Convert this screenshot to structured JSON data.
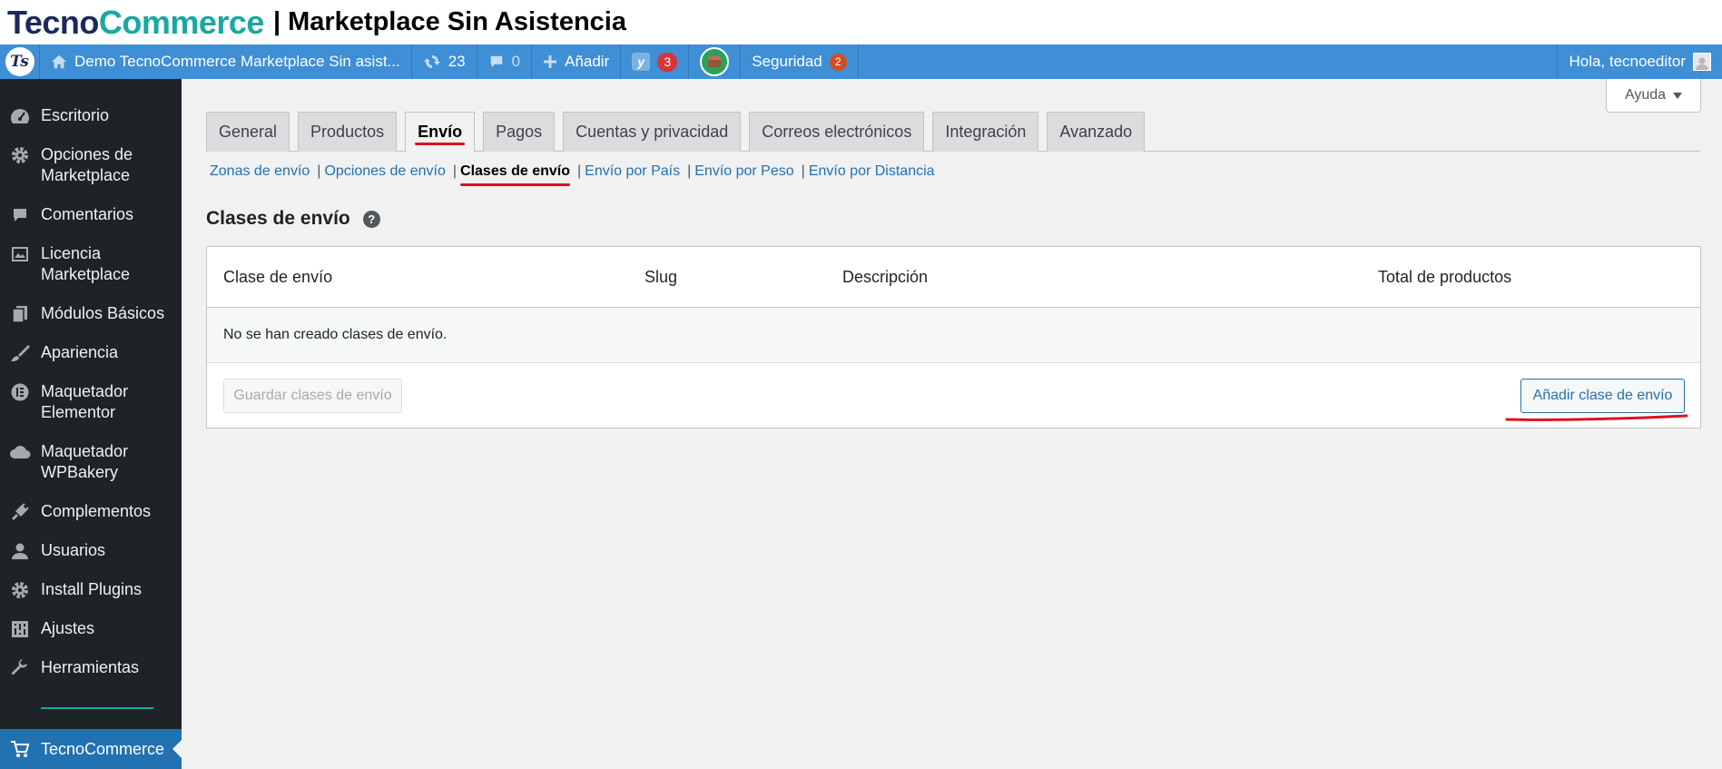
{
  "brand": {
    "part1": "Tecno",
    "part2": "Commerce",
    "title": "| Marketplace Sin Asistencia"
  },
  "adminbar": {
    "site_name": "Demo TecnoCommerce Marketplace Sin asist...",
    "updates_count": "23",
    "comments_count": "0",
    "add_label": "Añadir",
    "yoast_count": "3",
    "security_label": "Seguridad",
    "security_count": "2",
    "greeting": "Hola, tecnoeditor"
  },
  "help_label": "Ayuda",
  "sidebar": {
    "items": [
      {
        "label": "Escritorio",
        "icon": "dashboard-icon"
      },
      {
        "label": "Opciones de Marketplace",
        "icon": "gear-icon"
      },
      {
        "label": "Comentarios",
        "icon": "comment-icon"
      },
      {
        "label": "Licencia Marketplace",
        "icon": "license-icon"
      },
      {
        "label": "Módulos Básicos",
        "icon": "pages-icon"
      },
      {
        "label": "Apariencia",
        "icon": "brush-icon"
      },
      {
        "label": "Maquetador Elementor",
        "icon": "elementor-icon"
      },
      {
        "label": "Maquetador WPBakery",
        "icon": "cloud-icon"
      },
      {
        "label": "Complementos",
        "icon": "plugin-icon"
      },
      {
        "label": "Usuarios",
        "icon": "user-icon"
      },
      {
        "label": "Install Plugins",
        "icon": "gear-icon"
      },
      {
        "label": "Ajustes",
        "icon": "settings-icon"
      },
      {
        "label": "Herramientas",
        "icon": "wrench-icon"
      }
    ],
    "active": {
      "label": "TecnoCommerce",
      "icon": "cart-icon"
    }
  },
  "tabs": [
    "General",
    "Productos",
    "Envío",
    "Pagos",
    "Cuentas y privacidad",
    "Correos electrónicos",
    "Integración",
    "Avanzado"
  ],
  "active_tab": "Envío",
  "subnav": [
    "Zonas de envío",
    "Opciones de envío",
    "Clases de envío",
    "Envío por País",
    "Envío por Peso",
    "Envío por Distancia"
  ],
  "section_title": "Clases de envío",
  "table": {
    "headers": [
      "Clase de envío",
      "Slug",
      "Descripción",
      "Total de productos"
    ],
    "empty_message": "No se han creado clases de envío.",
    "save_button": "Guardar clases de envío",
    "add_button": "Añadir clase de envío"
  },
  "colors": {
    "accent": "#2271b1",
    "adminbar": "#3e8fd6",
    "annotation": "#e0101e",
    "brand_teal": "#19a8a3"
  }
}
